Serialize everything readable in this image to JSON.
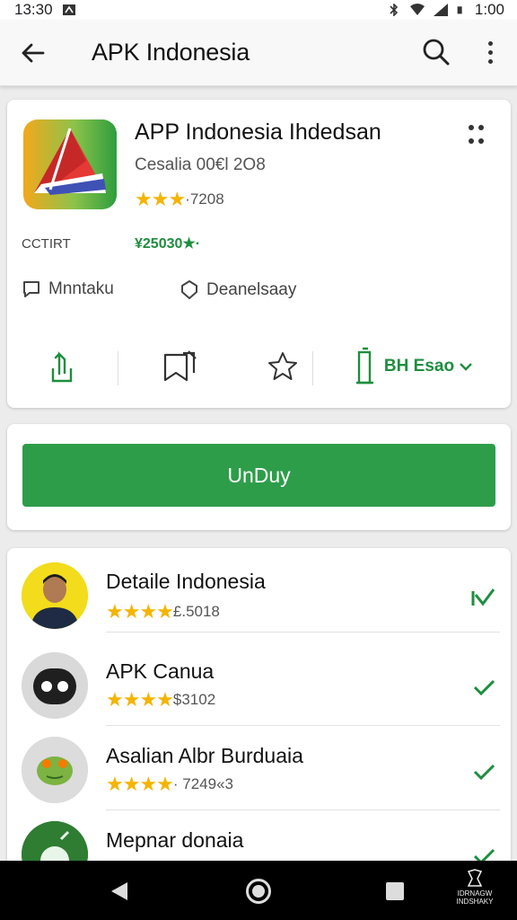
{
  "status_bar": {
    "time_left": "13:30",
    "time_right": "1:00"
  },
  "app_bar": {
    "title": "APK Indonesia"
  },
  "app": {
    "title": "APP Indonesia Ihdedsan",
    "developer": "Cesalia 00€l 2O8",
    "rating_stars": "★★★",
    "rating_count": "·7208",
    "meta_left": "CCTIRT",
    "meta_right": "¥25030★·",
    "tag_1": "Mnntaku",
    "tag_2": "Deanelsaay",
    "version_label": "BH Esao"
  },
  "install": {
    "label": "UnDuy"
  },
  "related": [
    {
      "name": "Detaile Indonesia",
      "stars": "★★★★",
      "count": "£.5018"
    },
    {
      "name": "APK Canua",
      "stars": "★★★★",
      "count": "$3102"
    },
    {
      "name": "Asalian Albr Burduaia",
      "stars": "★★★★",
      "count": "· 7249«3"
    },
    {
      "name": "Mepnar donaia",
      "stars": "",
      "count": ""
    }
  ],
  "nav_bar": {
    "watermark": "IDRNAGW INDSHAKY"
  },
  "colors": {
    "accent_green": "#2e9d4a",
    "star_yellow": "#f4b400"
  },
  "icons": [
    "back-arrow-icon",
    "search-icon",
    "overflow-menu-icon",
    "share-icon",
    "bookmark-icon",
    "star-outline-icon",
    "install-size-icon",
    "check-icon"
  ]
}
